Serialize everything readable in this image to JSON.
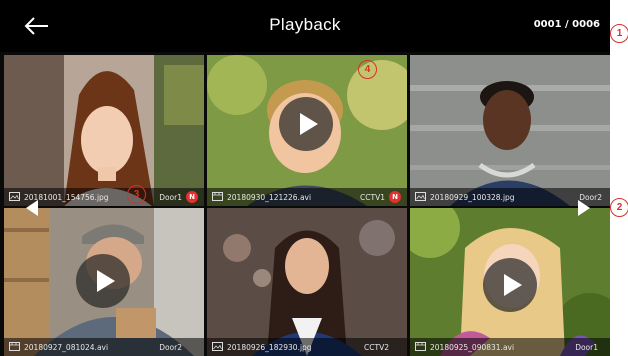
{
  "header": {
    "title": "Playback",
    "counter": "0001 / 0006"
  },
  "tiles": [
    {
      "filename": "20181001_154756.jpg",
      "camera": "Door1",
      "badge": "N",
      "type": "photo",
      "play": false
    },
    {
      "filename": "20180930_121226.avi",
      "camera": "CCTV1",
      "badge": "N",
      "type": "video",
      "play": true
    },
    {
      "filename": "20180929_100328.jpg",
      "camera": "Door2",
      "badge": "",
      "type": "photo",
      "play": false
    },
    {
      "filename": "20180927_081024.avi",
      "camera": "Door2",
      "badge": "",
      "type": "video",
      "play": true
    },
    {
      "filename": "20180926_182930.jpg",
      "camera": "CCTV2",
      "badge": "",
      "type": "photo",
      "play": false
    },
    {
      "filename": "20180925_090831.avi",
      "camera": "Door1",
      "badge": "",
      "type": "video",
      "play": true
    }
  ],
  "annotations": {
    "one": "1",
    "two": "2",
    "three": "3",
    "four": "4"
  },
  "colors": {
    "badge": "#e0322f",
    "annotation": "#d4322c"
  },
  "icons": {
    "back": "arrow-left-icon",
    "prev": "chevron-left-icon",
    "next": "chevron-right-icon",
    "play": "play-icon",
    "photo": "image-file-icon",
    "video": "video-file-icon"
  }
}
